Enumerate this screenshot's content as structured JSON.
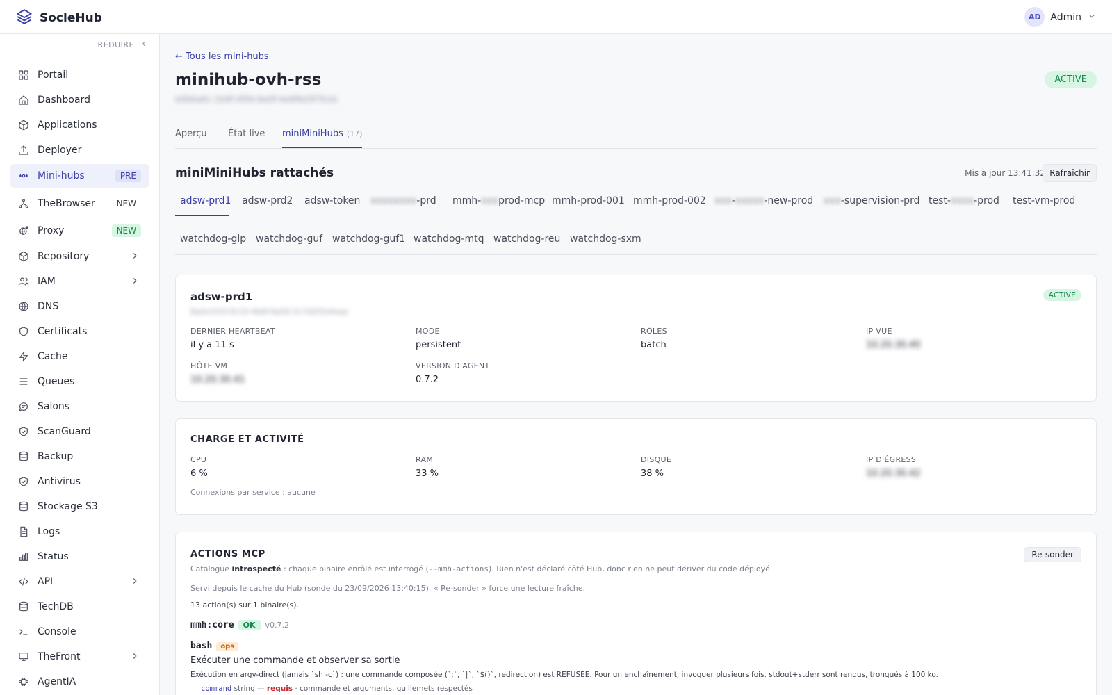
{
  "app": {
    "name": "SocleHub"
  },
  "user": {
    "initials": "AD",
    "name": "Admin"
  },
  "sidebar": {
    "collapse_label": "RÉDUIRE",
    "items": [
      {
        "label": "Portail",
        "icon": "grid-icon"
      },
      {
        "label": "Dashboard",
        "icon": "home-icon"
      },
      {
        "label": "Applications",
        "icon": "cube-icon"
      },
      {
        "label": "Deployer",
        "icon": "upload-icon"
      },
      {
        "label": "Mini-hubs",
        "icon": "hub-icon",
        "badge": "PRE",
        "active": true
      },
      {
        "label": "TheBrowser",
        "icon": "fork-icon",
        "badge": "NEW"
      },
      {
        "label": "Proxy",
        "icon": "proxy-icon",
        "badge": "NEW"
      },
      {
        "label": "Repository",
        "icon": "package-icon"
      },
      {
        "label": "IAM",
        "icon": "users-icon"
      },
      {
        "label": "DNS",
        "icon": "globe-icon"
      },
      {
        "label": "Certificats",
        "icon": "shield-icon"
      },
      {
        "label": "Cache",
        "icon": "bolt-icon"
      },
      {
        "label": "Queues",
        "icon": "list-icon"
      },
      {
        "label": "Salons",
        "icon": "chat-icon"
      },
      {
        "label": "ScanGuard",
        "icon": "shield-check-icon"
      },
      {
        "label": "Backup",
        "icon": "database-icon"
      },
      {
        "label": "Antivirus",
        "icon": "shield-check-icon"
      },
      {
        "label": "Stockage S3",
        "icon": "database-icon"
      },
      {
        "label": "Logs",
        "icon": "file-icon"
      },
      {
        "label": "Status",
        "icon": "bar-chart-icon"
      },
      {
        "label": "API",
        "icon": "code-icon"
      },
      {
        "label": "TechDB",
        "icon": "database-icon"
      },
      {
        "label": "Console",
        "icon": "terminal-icon"
      },
      {
        "label": "TheFront",
        "icon": "monitor-icon"
      },
      {
        "label": "AgentIA",
        "icon": "chip-icon"
      }
    ]
  },
  "page": {
    "back_link": "← Tous les mini-hubs",
    "title": "minihub-ovh-rss",
    "subtitle_redacted": "b0b6a6c-1b9f-4f00-8a0f-4e8f6d3f7b1b",
    "status": "ACTIVE",
    "tabs": [
      {
        "label": "Aperçu"
      },
      {
        "label": "État live"
      },
      {
        "label": "miniMiniHubs",
        "count": "(17)",
        "active": true
      }
    ]
  },
  "section": {
    "title": "miniMiniHubs rattachés",
    "updated": "Mis à jour 13:41:32",
    "refresh": "Rafraîchir"
  },
  "subtabs": {
    "row1": [
      {
        "label": "adsw-prd1",
        "active": true
      },
      {
        "label": "adsw-prd2"
      },
      {
        "label": "adsw-token"
      },
      {
        "label": "-prd",
        "redacted": "xxxxxxxx"
      },
      {
        "pre": "mmh-",
        "redacted": "xxx",
        "post": "prod-mcp"
      },
      {
        "label": "mmh-prod-001"
      },
      {
        "label": "mmh-prod-002"
      },
      {
        "pre": "",
        "redacted": "xxx",
        "mid": "-",
        "redacted2": "xxxxx",
        "post": "-new-prod"
      },
      {
        "redacted": "xxx",
        "post": "-supervision-prd"
      },
      {
        "pre": "test-",
        "redacted": "xxxx",
        "post": "-prod"
      },
      {
        "label": "test-vm-prod"
      }
    ],
    "row2": [
      {
        "label": "watchdog-glp"
      },
      {
        "label": "watchdog-guf"
      },
      {
        "label": "watchdog-guf1"
      },
      {
        "label": "watchdog-mtq"
      },
      {
        "label": "watchdog-reu"
      },
      {
        "label": "watchdog-sxm"
      }
    ]
  },
  "detail": {
    "name": "adsw-prd1",
    "status": "ACTIVE",
    "id_redacted": "8a2e1f10-0c14-4b6f-9a50-2c7d2f1b4eaa",
    "fields": [
      {
        "label": "DERNIER HEARTBEAT",
        "value": "il y a 11 s"
      },
      {
        "label": "MODE",
        "value": "persistent"
      },
      {
        "label": "RÔLES",
        "value": "batch"
      },
      {
        "label": "IP VUE",
        "value_redacted": "10.20.30.40"
      },
      {
        "label": "HÔTE VM",
        "value_redacted": "10.20.30.41"
      },
      {
        "label": "VERSION D'AGENT",
        "value": "0.7.2"
      }
    ]
  },
  "load": {
    "title": "CHARGE ET ACTIVITÉ",
    "fields": [
      {
        "label": "CPU",
        "value": "6 %"
      },
      {
        "label": "RAM",
        "value": "33 %"
      },
      {
        "label": "DISQUE",
        "value": "38 %"
      },
      {
        "label": "IP D'ÉGRESS",
        "value_redacted": "10.20.30.42"
      }
    ],
    "connections": "Connexions par service : aucune"
  },
  "mcp": {
    "title": "ACTIONS MCP",
    "resonder": "Re-sonder",
    "line1_pre": "Catalogue ",
    "line1_bold": "introspecté",
    "line1_mid": " : chaque binaire enrôlé est interrogé (",
    "line1_code": "--mmh-actions",
    "line1_post": "). Rien n'est déclaré côté Hub, donc rien ne peut dériver du code déployé.",
    "line2": "Servi depuis le cache du Hub (sonde du 23/09/2026 13:40:15). « Re-sonder » force une lecture fraîche.",
    "line3": "13 action(s) sur 1 binaire(s).",
    "binary": "mmh:core",
    "binary_status": "OK",
    "binary_version": "v0.7.2",
    "action_name": "bash",
    "action_tag": "ops",
    "action_title": "Exécuter une commande et observer sa sortie",
    "action_desc": "Exécution en argv-direct (jamais `sh -c`) : une commande composée (`;`, `|`, `$()`, redirection) est REFUSÉE. Pour un enchaînement, invoquer plusieurs fois. stdout+stderr sont rendus, tronqués à 100 ko.",
    "param_name": "command",
    "param_type": " string — ",
    "param_req": "requis",
    "param_desc": " · commande et arguments, guillemets respectés"
  },
  "colors": {
    "accent": "#3a3fa8",
    "active_bg": "#d6f5e3",
    "active_fg": "#16884a"
  }
}
